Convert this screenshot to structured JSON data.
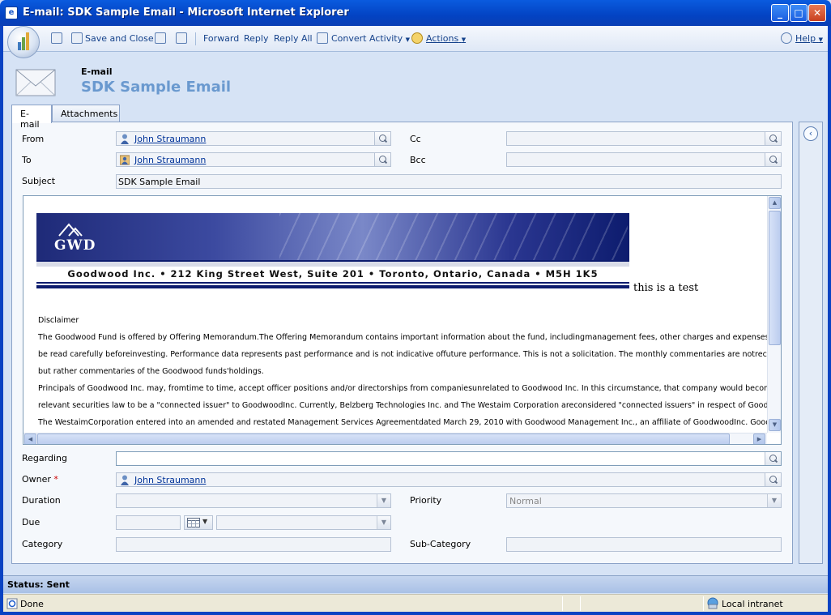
{
  "window": {
    "title": "E-mail: SDK Sample Email - Microsoft Internet Explorer"
  },
  "toolbar": {
    "save_close": "Save and Close",
    "forward": "Forward",
    "reply": "Reply",
    "reply_all": "Reply All",
    "convert_activity": "Convert Activity",
    "actions": "Actions",
    "help": "Help"
  },
  "header": {
    "entity_type": "E-mail",
    "record_title": "SDK Sample Email"
  },
  "tabs": [
    {
      "label": "E-mail",
      "active": true
    },
    {
      "label": "Attachments",
      "active": false
    }
  ],
  "fields": {
    "from_label": "From",
    "from_value": "John Straumann",
    "to_label": "To",
    "to_value": "John Straumann",
    "cc_label": "Cc",
    "bcc_label": "Bcc",
    "subject_label": "Subject",
    "subject_value": "SDK Sample Email",
    "regarding_label": "Regarding",
    "owner_label": "Owner",
    "owner_required": "*",
    "owner_value": "John Straumann",
    "duration_label": "Duration",
    "priority_label": "Priority",
    "priority_value": "Normal",
    "due_label": "Due",
    "category_label": "Category",
    "subcategory_label": "Sub-Category"
  },
  "email_body": {
    "banner_logo": "GWD",
    "banner_address": "Goodwood Inc. • 212 King Street West, Suite 201 • Toronto, Ontario, Canada  •  M5H 1K5",
    "test_text": "this is a test",
    "disclaimer_title": "Disclaimer",
    "lines": [
      "The Goodwood Fund is offered by Offering Memorandum.The Offering Memorandum contains important information about the fund, includingmanagement fees, other charges and expenses and shoul",
      "be read carefully beforeinvesting. Performance data represents past performance and is not indicative offuture performance. This is not a solicitation. The monthly commentaries are notrecommendations",
      "but rather commentaries of the Goodwood funds'holdings.",
      "Principals of Goodwood Inc. may, fromtime to time, accept officer positions and/or directorships from companiesunrelated to Goodwood Inc. In this circumstance, that company would beconsidered ur",
      "relevant securities law to be a \"connected issuer\" to GoodwoodInc. Currently, Belzberg Technologies Inc. and The Westaim Corporation areconsidered \"connected issuers\" in respect of Goodwood Inc.",
      "The WestaimCorporation entered into an amended and restated Management Services Agreementdated March 29, 2010 with Goodwood Management Inc., an affiliate of GoodwoodInc. Goodwood Inc."
    ]
  },
  "status": {
    "crm_status": "Status: Sent",
    "ie_status": "Done",
    "zone": "Local intranet"
  },
  "colors": {
    "title_bar": "#0343c3",
    "header_title": "#6a99cf",
    "link": "#003399"
  }
}
